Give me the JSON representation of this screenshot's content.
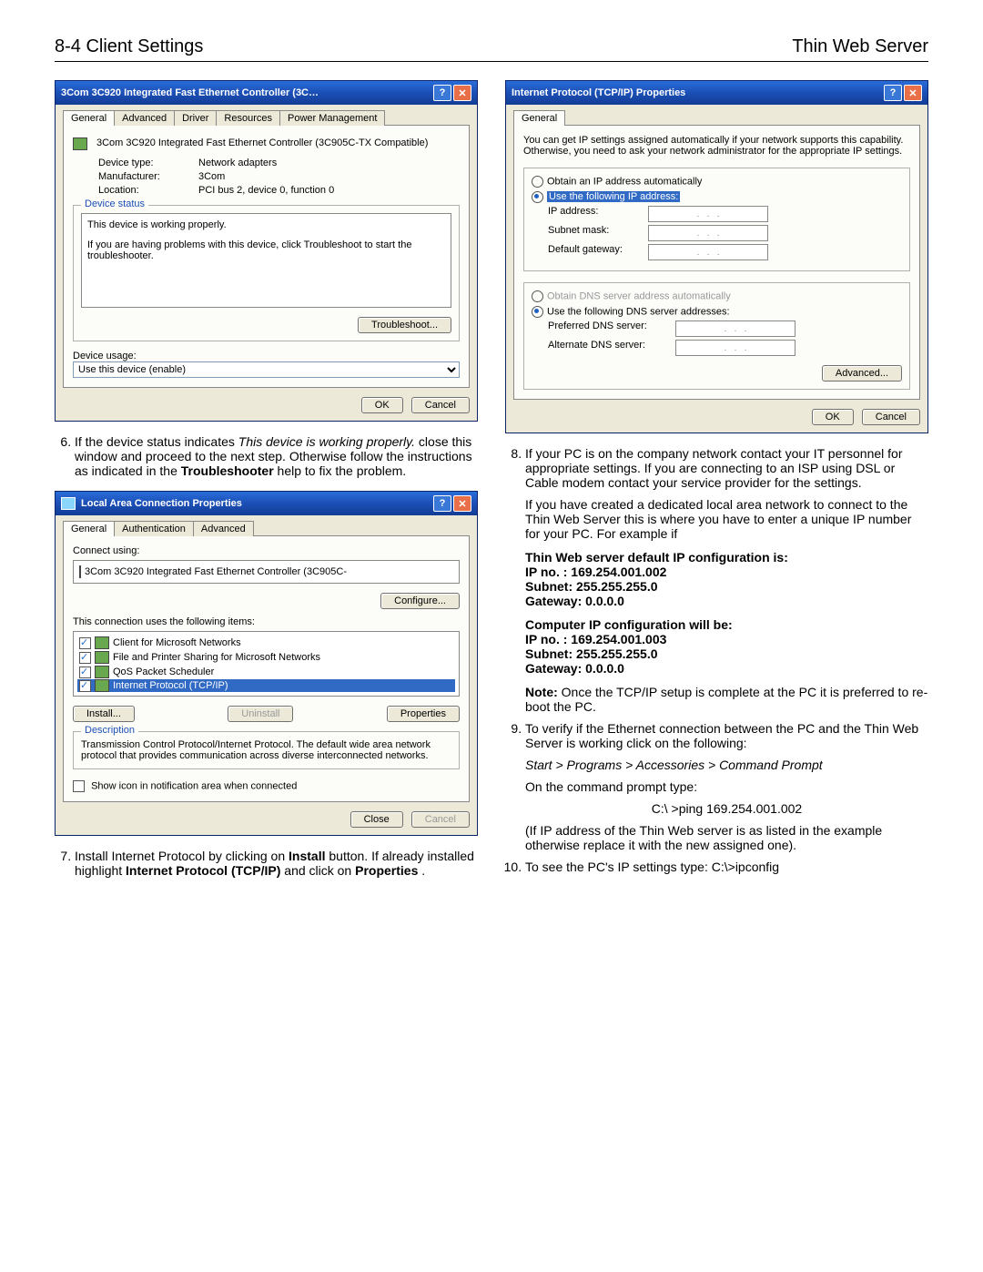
{
  "header": {
    "left": "8-4   Client Settings",
    "right": "Thin Web Server"
  },
  "win1": {
    "title": "3Com 3C920 Integrated Fast Ethernet Controller (3C…",
    "tabs": [
      "General",
      "Advanced",
      "Driver",
      "Resources",
      "Power Management"
    ],
    "devname": "3Com 3C920 Integrated Fast Ethernet Controller (3C905C-TX Compatible)",
    "rows": {
      "devtype_l": "Device type:",
      "devtype_v": "Network adapters",
      "mfr_l": "Manufacturer:",
      "mfr_v": "3Com",
      "loc_l": "Location:",
      "loc_v": "PCI bus 2, device 0, function 0"
    },
    "status_legend": "Device status",
    "status_line1": "This device is working properly.",
    "status_line2": "If you are having problems with this device, click Troubleshoot to start the troubleshooter.",
    "troubleshoot": "Troubleshoot...",
    "usage_l": "Device usage:",
    "usage_v": "Use this device (enable)",
    "ok": "OK",
    "cancel": "Cancel"
  },
  "win2": {
    "title": "Local Area Connection Properties",
    "tabs": [
      "General",
      "Authentication",
      "Advanced"
    ],
    "connect_l": "Connect using:",
    "adapter": "3Com 3C920 Integrated Fast Ethernet Controller (3C905C-",
    "configure": "Configure...",
    "items_l": "This connection uses the following items:",
    "items": [
      "Client for Microsoft Networks",
      "File and Printer Sharing for Microsoft Networks",
      "QoS Packet Scheduler",
      "Internet Protocol (TCP/IP)"
    ],
    "install": "Install...",
    "uninstall": "Uninstall",
    "properties": "Properties",
    "desc_legend": "Description",
    "desc": "Transmission Control Protocol/Internet Protocol. The default wide area network protocol that provides communication across diverse interconnected networks.",
    "show_icon": "Show icon in notification area when connected",
    "close": "Close",
    "cancel": "Cancel"
  },
  "win3": {
    "title": "Internet Protocol (TCP/IP) Properties",
    "tab": "General",
    "intro": "You can get IP settings assigned automatically if your network supports this capability. Otherwise, you need to ask your network administrator for the appropriate IP settings.",
    "r1": "Obtain an IP address automatically",
    "r2": "Use the following IP address:",
    "ip_l": "IP address:",
    "sub_l": "Subnet mask:",
    "gw_l": "Default gateway:",
    "r3": "Obtain DNS server address automatically",
    "r4": "Use the following DNS server addresses:",
    "pdns_l": "Preferred DNS server:",
    "adns_l": "Alternate DNS server:",
    "advanced": "Advanced...",
    "ok": "OK",
    "cancel": "Cancel"
  },
  "text": {
    "p6a": "If the device status indicates ",
    "p6i": "This device is working properly.",
    "p6b": "  close this window and proceed to the next step. Otherwise follow the instructions as indicated in the ",
    "p6bold": "Troubleshooter",
    "p6c": " help to fix the problem.",
    "p7a": "Install Internet Protocol by clicking on ",
    "p7bold1": "Install",
    "p7b": " button. If already installed highlight ",
    "p7bold2": "Internet Protocol (TCP/IP)",
    "p7c": " and click on ",
    "p7bold3": "Properties",
    "p7d": ".",
    "p8": "If your PC is on the company network contact your IT personnel for appropriate settings. If you are connecting to an ISP using DSL or Cable modem contact your service provider for the settings.",
    "p8b": "If you have created a dedicated local area network to connect to the Thin Web Server this is where you have to enter a unique IP number for your PC.  For example if",
    "cfg1_title": "Thin Web server default IP configuration is:",
    "cfg1_ip": "IP no.  : 169.254.001.002",
    "cfg1_sub": "Subnet: 255.255.255.0",
    "cfg1_gw": "Gateway: 0.0.0.0",
    "cfg2_title": "Computer IP configuration will be:",
    "cfg2_ip": "IP no.  : 169.254.001.003",
    "cfg2_sub": "Subnet: 255.255.255.0",
    "cfg2_gw": "Gateway: 0.0.0.0",
    "note": "Note:",
    "note_body": "Once the TCP/IP setup is complete at the PC it is preferred to re-boot the PC.",
    "p9": "To verify if the Ethernet connection between the PC and the Thin Web Server is working click on the following:",
    "path": "Start > Programs > Accessories > Command Prompt",
    "p9b": "On the command prompt type:",
    "cmd1": "C:\\ >ping 169.254.001.002",
    "p9c": "(If IP address of the Thin Web server is as listed in the example otherwise replace it with the new assigned one).",
    "p10a": "To see the PC's IP settings type:  ",
    "cmd2": "C:\\>ipconfig"
  }
}
